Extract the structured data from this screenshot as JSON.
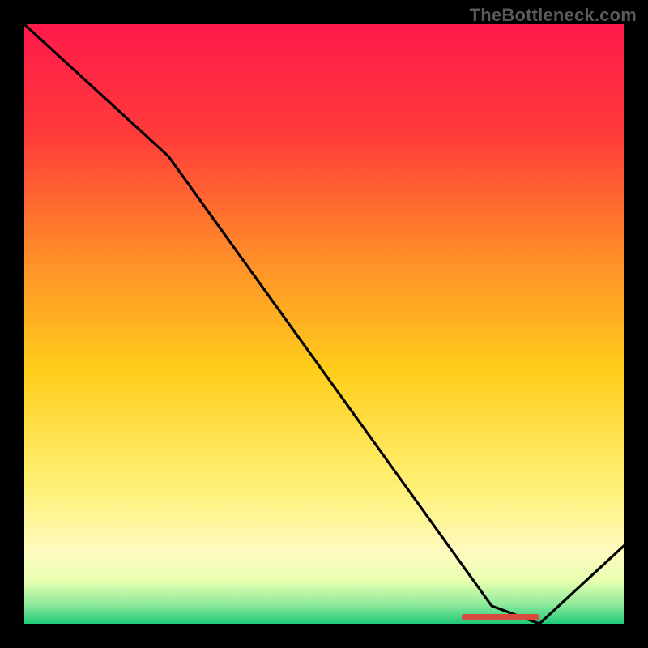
{
  "watermark": "TheBottleneck.com",
  "marker_label": "",
  "chart_data": {
    "type": "line",
    "title": "",
    "xlabel": "",
    "ylabel": "",
    "x_range": [
      0,
      100
    ],
    "y_range": [
      0,
      100
    ],
    "grid": false,
    "legend": false,
    "background_gradient": {
      "top": "#ff1a4b",
      "upper": "#ff7a2a",
      "mid": "#ffd21a",
      "lower": "#fff9a5",
      "bottom": "#25d366"
    },
    "series": [
      {
        "name": "curve",
        "x": [
          0,
          24,
          78,
          86,
          100
        ],
        "values": [
          100,
          78,
          3,
          0,
          13
        ]
      }
    ],
    "min_region": {
      "x_start": 73,
      "x_end": 86
    }
  }
}
